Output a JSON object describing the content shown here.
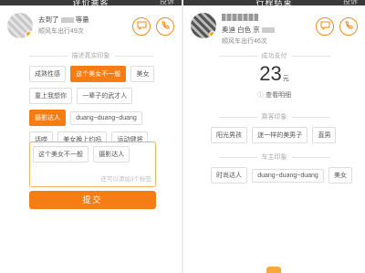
{
  "colors": {
    "accent": "#f57d13",
    "accent_border": "#f3b05f",
    "topbar": "#3a3a3a"
  },
  "left": {
    "topbar_title": "评价乘客",
    "topbar_action": "投诉",
    "profile": {
      "line1_prefix": "去到了",
      "line1_suffix": "等量",
      "line2": "顺风车出行49次"
    },
    "section_title": "描述真实印象",
    "tags_rows": [
      [
        {
          "label": "成熟性感",
          "on": false
        },
        {
          "label": "这个美女不一般",
          "on": true
        },
        {
          "label": "美女",
          "on": false
        }
      ],
      [
        {
          "label": "童上我想你",
          "on": false
        },
        {
          "label": "一辈子的武才人",
          "on": false
        }
      ],
      [
        {
          "label": "摄影达人",
          "on": true
        },
        {
          "label": "duang~duang~duang",
          "on": false
        }
      ],
      [
        {
          "label": "话唠",
          "on": false
        },
        {
          "label": "美女晚上约吗",
          "on": false
        },
        {
          "label": "运动健将",
          "on": false
        }
      ]
    ],
    "selected_tags": [
      "这个美女不一般",
      "摄影达人"
    ],
    "counter": "还可以添加3个标签",
    "submit_label": "提交"
  },
  "right": {
    "topbar_title": "行程结束",
    "topbar_action": "投诉",
    "profile": {
      "line1": "奥迪 白色 京",
      "line2": "顺风车出行46次"
    },
    "fare_section_title": "成功支付",
    "fare_amount": "23",
    "fare_unit": "元",
    "fare_detail": "查看明细",
    "fare_detail_icon": "ⓘ",
    "section1_title": "乘客印象",
    "tags1": [
      "阳光男孩",
      "迷一样的美男子",
      "直男"
    ],
    "section2_title": "车主印象",
    "tags2": [
      "时尚达人",
      "duang~duang~duang",
      "美女"
    ]
  }
}
